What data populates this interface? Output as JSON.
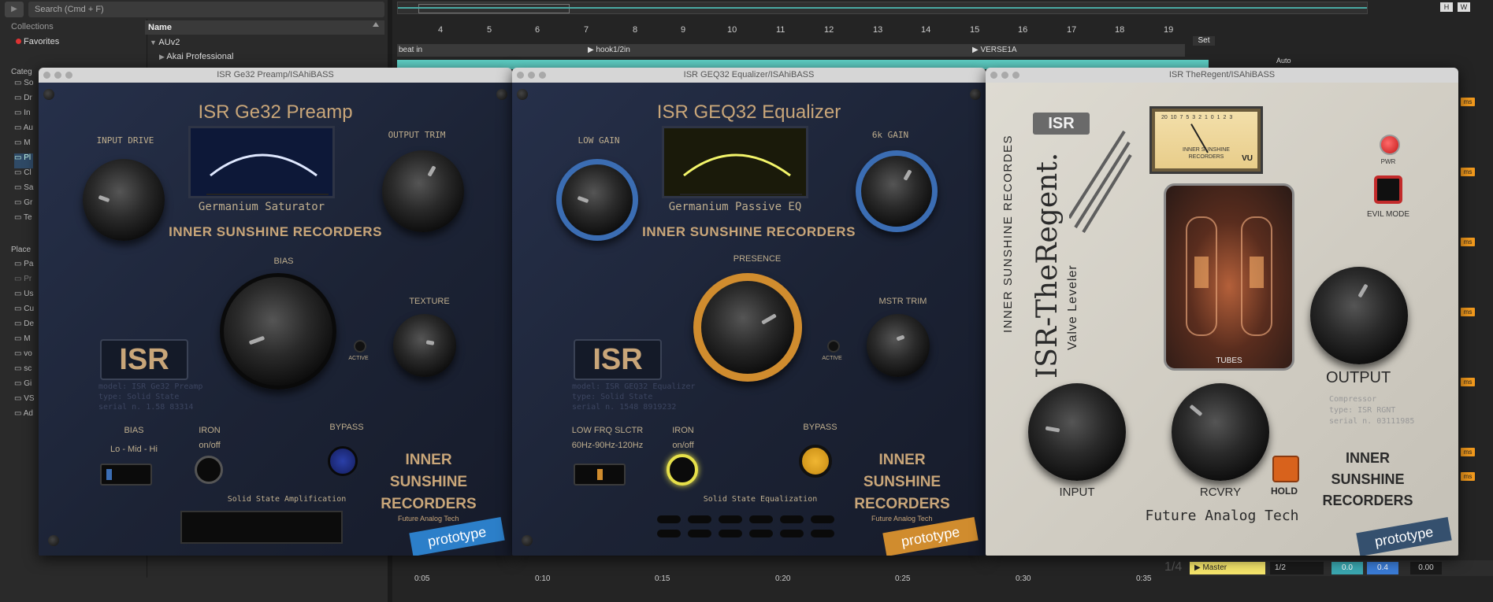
{
  "browser": {
    "search_placeholder": "Search (Cmd + F)",
    "collections_label": "Collections",
    "favorites_label": "Favorites",
    "categories_label": "Categ",
    "places_label": "Place",
    "name_header": "Name",
    "tree": [
      "AUv2",
      "Akai Professional"
    ],
    "category_items": [
      "So",
      "Dr",
      "In",
      "Au",
      "M",
      "Pl",
      "Cl",
      "Sa",
      "Gr",
      "Te"
    ],
    "place_items": [
      "Pa",
      "Pr",
      "Us",
      "Cu",
      "De",
      "M",
      "vo",
      "sc",
      "Gi",
      "VS",
      "Ad"
    ]
  },
  "arrangement": {
    "ruler": [
      "4",
      "5",
      "6",
      "7",
      "8",
      "9",
      "10",
      "11",
      "12",
      "13",
      "14",
      "15",
      "16",
      "17",
      "18",
      "19"
    ],
    "locators": [
      "beat in",
      "hook1/2in",
      "VERSE1A"
    ],
    "set_label": "Set",
    "times": [
      "0:05",
      "0:10",
      "0:15",
      "0:20",
      "0:25",
      "0:30",
      "0:35"
    ],
    "hw_labels": [
      "H",
      "W"
    ],
    "master_label": "Master",
    "mixer_values": [
      "1/2",
      "0.0",
      "0.4",
      "0.00"
    ],
    "time_sig": "1/4",
    "automation_label": "Auto"
  },
  "plugins": {
    "preamp": {
      "window_title": "ISR Ge32 Preamp/ISAhiBASS",
      "title": "ISR Ge32 Preamp",
      "input_drive": "INPUT DRIVE",
      "output_trim": "OUTPUT TRIM",
      "subtitle": "Germanium Saturator",
      "brand": "INNER SUNSHINE RECORDERS",
      "bias_knob": "BIAS",
      "texture": "TEXTURE",
      "active": "ACTIVE",
      "logo": "ISR",
      "model_lines": [
        "model: ISR Ge32 Preamp",
        "type: Solid State",
        "serial n. 1.58 83314"
      ],
      "bias_switch": "BIAS",
      "bias_range": "Lo - Mid - Hi",
      "iron": "IRON",
      "iron_state": "on/off",
      "bypass": "BYPASS",
      "footer": "Solid State Amplification",
      "corner_brand": [
        "INNER",
        "SUNSHINE",
        "RECORDERS"
      ],
      "future": "Future Analog Tech",
      "prototype": "prototype"
    },
    "eq": {
      "window_title": "ISR GEQ32 Equalizer/ISAhiBASS",
      "title": "ISR GEQ32 Equalizer",
      "low_gain": "LOW GAIN",
      "high_gain": "6k GAIN",
      "subtitle": "Germanium Passive EQ",
      "brand": "INNER SUNSHINE RECORDERS",
      "presence": "PRESENCE",
      "mstr_trim": "MSTR TRIM",
      "active": "ACTIVE",
      "logo": "ISR",
      "model_lines": [
        "model: ISR GEQ32 Equalizer",
        "type: Solid State",
        "serial n. 1548 8919232"
      ],
      "low_frq": "LOW FRQ SLCTR",
      "frq_range": "60Hz-90Hz-120Hz",
      "iron": "IRON",
      "iron_state": "on/off",
      "bypass": "BYPASS",
      "footer": "Solid State Equalization",
      "corner_brand": [
        "INNER",
        "SUNSHINE",
        "RECORDERS"
      ],
      "future": "Future Analog Tech",
      "prototype": "prototype"
    },
    "regent": {
      "window_title": "ISR TheRegent/ISAhiBASS",
      "logo": "ISR",
      "vertical_brand": "INNER SUNSHINE RECORDES",
      "name": "ISR-TheRegent.",
      "subname": "Valve Leveler",
      "vu_label": "VU",
      "vu_brand": [
        "INNER SUNSHINE",
        "RECORDERS"
      ],
      "vu_scale": [
        "20",
        "10",
        "7",
        "5",
        "3",
        "2",
        "1",
        "0",
        "1",
        "2",
        "3"
      ],
      "tubes": "TUBES",
      "pwr": "PWR",
      "evil_mode": "EVIL MODE",
      "output": "OUTPUT",
      "info_lines": [
        "Compressor",
        "type: ISR RGNT",
        "serial n. 03111985"
      ],
      "input": "INPUT",
      "rcvry": "RCVRY",
      "hold": "HOLD",
      "corner_brand": [
        "INNER",
        "SUNSHINE",
        "RECORDERS"
      ],
      "future": "Future Analog Tech",
      "prototype": "prototype"
    }
  },
  "colors": {
    "accent_blue": "#3b6db3",
    "accent_gold": "#d08c2e",
    "track_teal": "#5fd0c6",
    "badge_orange": "#f29a1d"
  }
}
